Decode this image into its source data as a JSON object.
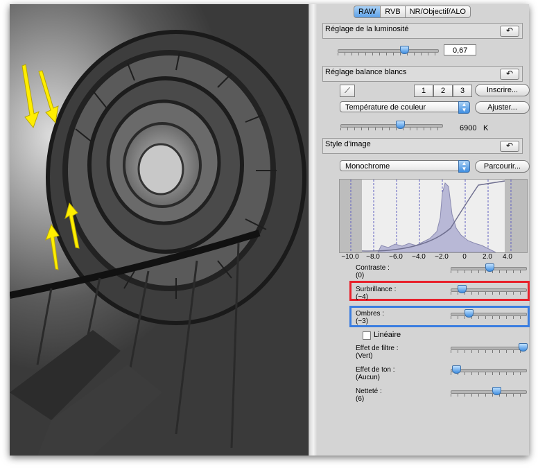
{
  "tabs": [
    "RAW",
    "RVB",
    "NR/Objectif/ALO"
  ],
  "brightness": {
    "title": "Réglage de la luminosité",
    "value": "0,67",
    "level": 0.67
  },
  "white_balance": {
    "title": "Réglage balance blancs",
    "presets": [
      "1",
      "2",
      "3"
    ],
    "register_label": "Inscrire...",
    "mode": "Température de couleur",
    "adjust_label": "Ajuster...",
    "temperature": "6900",
    "unit": "K"
  },
  "picture_style": {
    "title": "Style d'image",
    "selected": "Monochrome",
    "browse_label": "Parcourir...",
    "histogram_ticks": [
      "−10.0",
      "−8.0",
      "−6.0",
      "−4.0",
      "−2.0",
      "0",
      "2.0",
      "4.0"
    ],
    "params": [
      {
        "label": "Contraste :",
        "value": "(0)",
        "level": 0
      },
      {
        "label": "Surbrillance :",
        "value": "(−4)",
        "level": -4
      },
      {
        "label": "Ombres :",
        "value": "(−3)",
        "level": -3
      },
      {
        "label": "Effet de filtre :",
        "value": "(Vert)"
      },
      {
        "label": "Effet de ton :",
        "value": "(Aucun)"
      },
      {
        "label": "Netteté :",
        "value": "(6)",
        "level": 6
      }
    ],
    "linear_label": "Linéaire"
  },
  "colors": {
    "arrow": "#ffee00",
    "highlight_red": "#e8202a",
    "highlight_blue": "#3a7de0",
    "tab_active": "#5ea2e8"
  },
  "icons": {
    "reset": "undo-arrow-icon",
    "eyedropper": "eyedropper-icon",
    "select_arrow": "updown-arrow-icon"
  }
}
